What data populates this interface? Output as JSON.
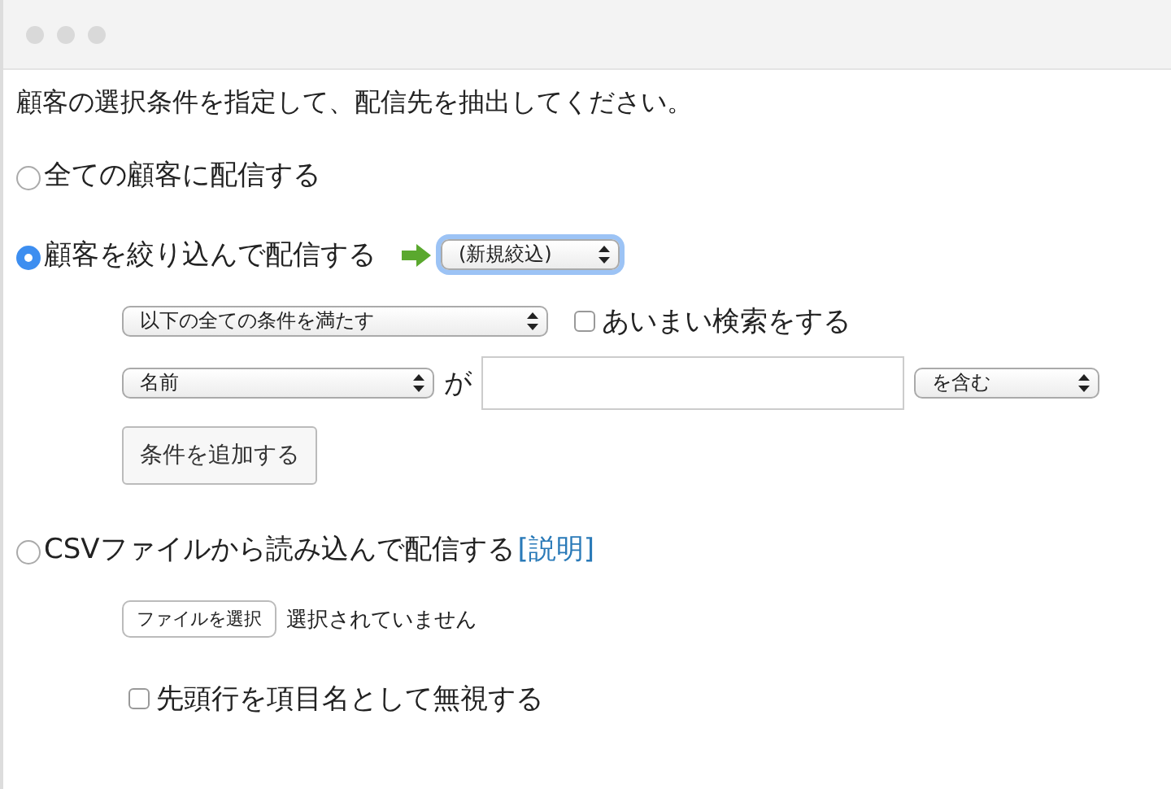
{
  "instruction": "顧客の選択条件を指定して、配信先を抽出してください。",
  "options": [
    {
      "label": "全ての顧客に配信する",
      "selected": false
    },
    {
      "label": "顧客を絞り込んで配信する",
      "selected": true
    },
    {
      "label": "CSVファイルから読み込んで配信する",
      "selected": false,
      "link": "[説明]"
    }
  ],
  "filter_preset": {
    "value": "(新規絞込)",
    "focused": true
  },
  "match_mode": {
    "value": "以下の全ての条件を満たす"
  },
  "fuzzy_search": {
    "label": "あいまい検索をする",
    "checked": false
  },
  "condition": {
    "field": "名前",
    "particle": "が",
    "operator": "を含む"
  },
  "add_condition_button": "条件を追加する",
  "csv": {
    "file_button": "ファイルを選択",
    "file_status": "選択されていません",
    "skip_header": {
      "label": "先頭行を項目名として無視する",
      "checked": false
    }
  }
}
